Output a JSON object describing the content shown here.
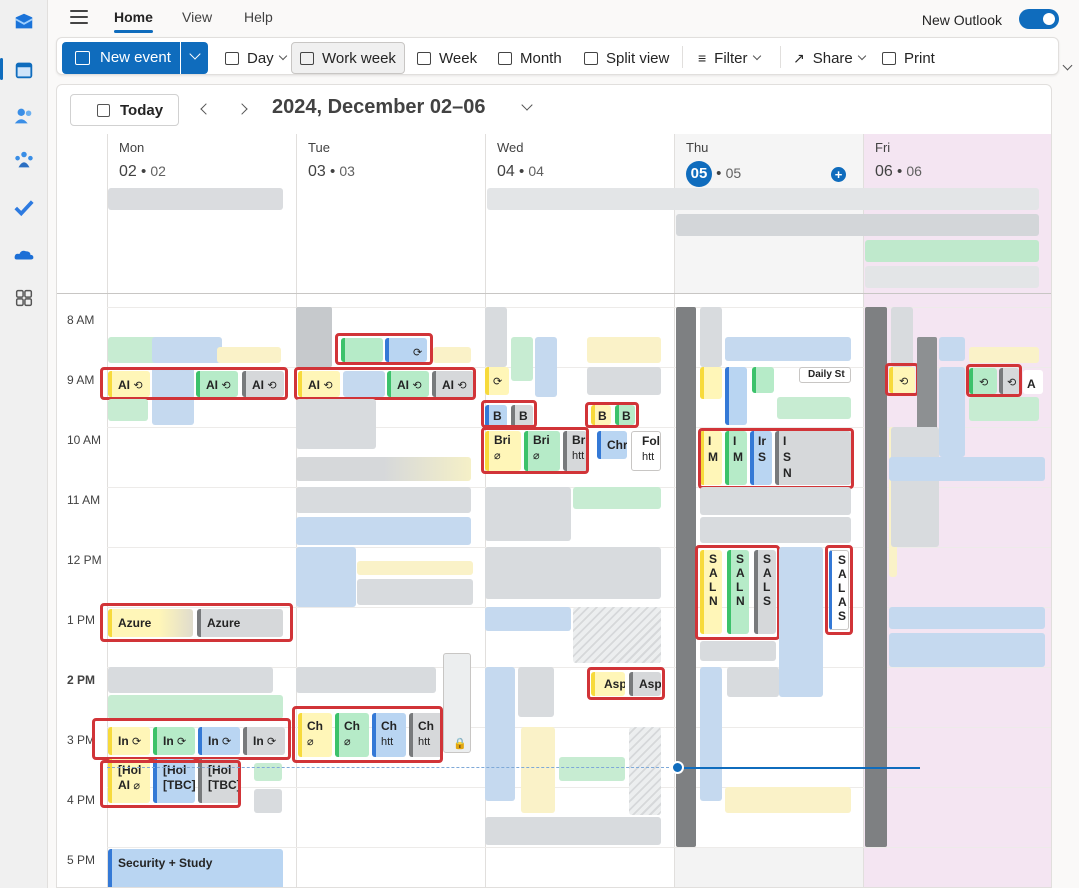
{
  "app": {
    "toggle_label": "New Outlook",
    "toggle_on": true
  },
  "nav_tabs": [
    {
      "label": "Home",
      "active": true
    },
    {
      "label": "View"
    },
    {
      "label": "Help"
    }
  ],
  "rail_icons": [
    "outlook-logo-icon",
    "calendar-icon",
    "people-icon",
    "groups-icon",
    "todo-icon",
    "onedrive-icon",
    "apps-icon"
  ],
  "ribbon": {
    "new_event": "New event",
    "views": [
      {
        "label": "Day",
        "icon": "day-icon",
        "dropdown": true
      },
      {
        "label": "Work week",
        "icon": "work-week-icon",
        "selected": true
      },
      {
        "label": "Week",
        "icon": "week-icon"
      },
      {
        "label": "Month",
        "icon": "month-icon"
      },
      {
        "label": "Split view",
        "icon": "split-view-icon"
      }
    ],
    "filter": "Filter",
    "share": "Share",
    "print": "Print"
  },
  "calendar": {
    "today_button": "Today",
    "date_range": "2024, December 02–06",
    "days": [
      {
        "name": "Mon",
        "num": "02",
        "sub": "02"
      },
      {
        "name": "Tue",
        "num": "03",
        "sub": "03"
      },
      {
        "name": "Wed",
        "num": "04",
        "sub": "04"
      },
      {
        "name": "Thu",
        "num": "05",
        "sub": "05",
        "today": true
      },
      {
        "name": "Fri",
        "num": "06",
        "sub": "06"
      }
    ],
    "hours": [
      "8 AM",
      "9 AM",
      "10 AM",
      "11 AM",
      "12 PM",
      "1 PM",
      "2 PM",
      "3 PM",
      "4 PM",
      "5 PM"
    ],
    "current_hour_label": "2 PM",
    "events": {
      "mon_ai": [
        "AI",
        "AI",
        "AI"
      ],
      "mon_azure": [
        "Azure",
        "Azure"
      ],
      "mon_in": [
        "In",
        "In",
        "In",
        "In"
      ],
      "mon_hol": [
        {
          "l1": "[Hol",
          "l2": "AI"
        },
        {
          "l1": "[Hol",
          "l2": "[TBC]"
        },
        {
          "l1": "[Hol",
          "l2": "[TBC]"
        }
      ],
      "mon_security": "Security + Study",
      "tue_ai": [
        "AI",
        "AI",
        "AI"
      ],
      "tue_ch": [
        {
          "l1": "Ch",
          "l2": ""
        },
        {
          "l1": "Ch",
          "l2": ""
        },
        {
          "l1": "Ch",
          "l2": "htt"
        },
        {
          "l1": "Ch",
          "l2": "htt"
        }
      ],
      "wed_b": [
        "B",
        "B",
        "B",
        "B"
      ],
      "wed_bri": [
        {
          "l1": "Bri",
          "l2": ""
        },
        {
          "l1": "Bri",
          "l2": ""
        },
        {
          "l1": "Bri",
          "l2": "htt"
        }
      ],
      "wed_chr": "Chr",
      "wed_fol": {
        "l1": "Fol",
        "l2": "htt"
      },
      "wed_asp": [
        "Asp",
        "Asp"
      ],
      "thu_daily": "Daily St",
      "thu_im": [
        "I",
        "M",
        "I",
        "M",
        "Ir",
        "S",
        "I",
        "S",
        "N"
      ],
      "thu_sal": [
        [
          "S",
          "A",
          "L",
          "N"
        ],
        [
          "S",
          "A",
          "L",
          "N"
        ],
        [
          "S",
          "A",
          "L",
          "S"
        ],
        [
          "S",
          "A",
          "L",
          "A",
          "S"
        ]
      ],
      "fri_a": "A"
    }
  }
}
